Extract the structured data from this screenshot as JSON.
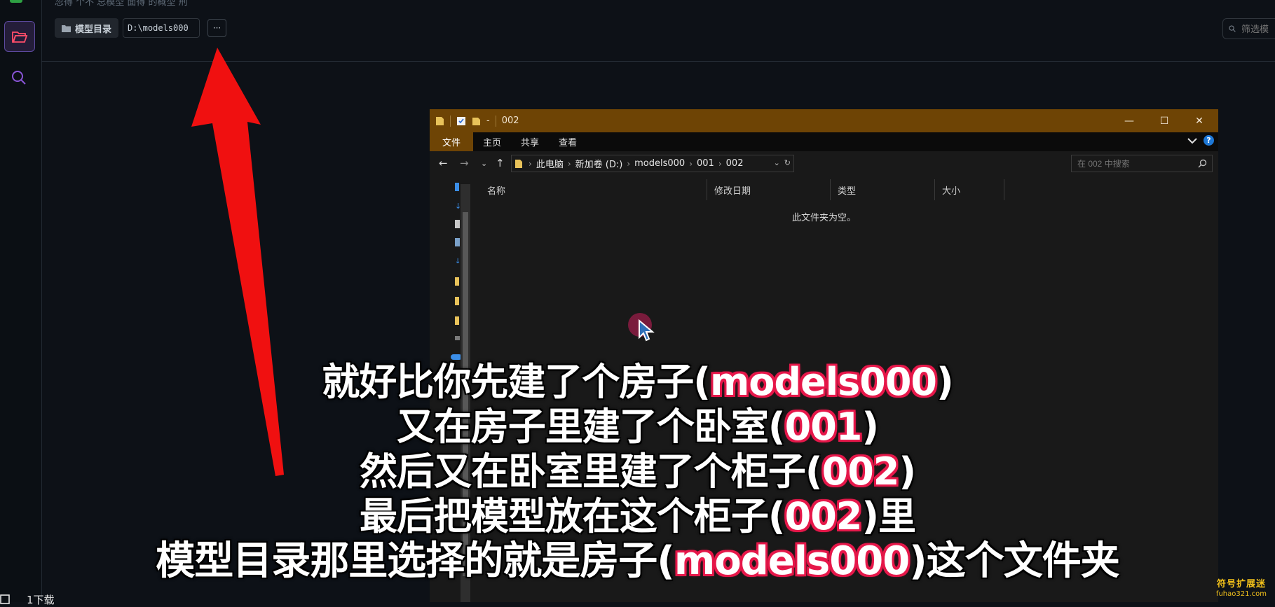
{
  "app": {
    "top_hint": "忽得 个不 总模型 面得 的概型 刑",
    "model_dir_label": "模型目录",
    "model_dir_value": "D:\\models000",
    "more_label": "···",
    "filter_placeholder": "筛选模",
    "bottom_status": "1下载"
  },
  "explorer": {
    "title": "002",
    "title_dash": "-",
    "controls": {
      "minimize": "—",
      "maximize": "☐",
      "close": "✕"
    },
    "ribbon_tabs": [
      "文件",
      "主页",
      "共享",
      "查看"
    ],
    "help": "?",
    "breadcrumb": [
      "此电脑",
      "新加卷 (D:)",
      "models000",
      "001",
      "002"
    ],
    "search_placeholder": "在 002 中搜索",
    "columns": [
      "名称",
      "修改日期",
      "类型",
      "大小"
    ],
    "empty_message": "此文件夹为空。"
  },
  "subtitles": [
    [
      {
        "t": "就好比你先建了个房子(",
        "h": false
      },
      {
        "t": "models000",
        "h": true
      },
      {
        "t": ")",
        "h": false
      }
    ],
    [
      {
        "t": "又在房子里建了个卧室(",
        "h": false
      },
      {
        "t": "001",
        "h": true
      },
      {
        "t": ")",
        "h": false
      }
    ],
    [
      {
        "t": "然后又在卧室里建了个柜子(",
        "h": false
      },
      {
        "t": "002",
        "h": true
      },
      {
        "t": ")",
        "h": false
      }
    ],
    [
      {
        "t": "最后把模型放在这个柜子(",
        "h": false
      },
      {
        "t": "002",
        "h": true
      },
      {
        "t": ")里",
        "h": false
      }
    ],
    [
      {
        "t": "模型目录那里选择的就是房子(",
        "h": false
      },
      {
        "t": "models000",
        "h": true
      },
      {
        "t": ")这个文件夹",
        "h": false
      }
    ]
  ],
  "watermark": {
    "line1": "符号扩展迷",
    "line2": "fuhao321.com"
  },
  "colors": {
    "arrow": "#f01010",
    "highlight": "#e6194b",
    "title_bar": "#6e4405",
    "accent": "#5d4aa0"
  },
  "icons": [
    "folder-icon",
    "search-icon",
    "arrow-icon",
    "back-icon",
    "forward-icon",
    "up-icon",
    "refresh-icon",
    "cursor-icon"
  ]
}
